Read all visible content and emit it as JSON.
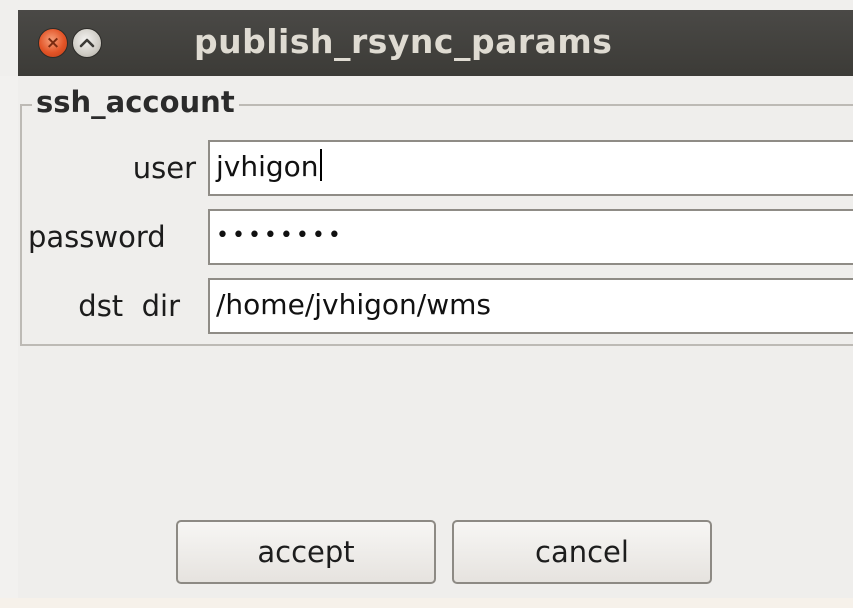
{
  "window": {
    "title": "publish_rsync_params",
    "close_glyph": "×"
  },
  "group": {
    "legend": "ssh_account"
  },
  "fields": {
    "user": {
      "label": "user",
      "value": "jvhigon"
    },
    "password": {
      "label": "password",
      "value": "••••••••"
    },
    "dst_dir": {
      "label": "dst  dir",
      "value": "/home/jvhigon/wms"
    }
  },
  "buttons": {
    "accept": "accept",
    "cancel": "cancel"
  },
  "colors": {
    "titlebar": "#3c3b37",
    "close_button": "#e35427",
    "panel": "#efeeec"
  },
  "icons": [
    "close-icon",
    "maximize-icon"
  ]
}
